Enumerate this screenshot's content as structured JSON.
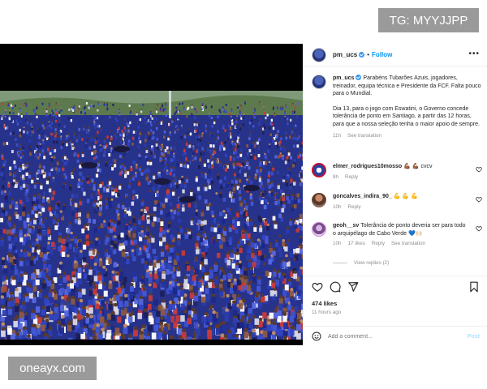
{
  "watermarks": {
    "top": "TG: MYYJJPP",
    "bottom": "oneayx.com"
  },
  "media": {
    "description_icon": "crowd-photo"
  },
  "post": {
    "username": "pm_ucs",
    "follow_label": "Follow",
    "caption_p1": "Parabéns Tubarões Azuis, jogadores, treinador, equipa técnica e Presidente da FCF. Falta pouco para o Mundial.",
    "caption_p2": "Dia 13, para o jogo com Eswatini, o Governo concede tolerância de ponto em Santiago, a partir das 12 horas, para que a nossa seleção tenha o maior apoio de sempre.",
    "caption_time": "11h",
    "see_translation": "See translation"
  },
  "comments": [
    {
      "user": "elmer_rodrigues10mosso",
      "text": "💪🏾 💪🏾 cvcv",
      "time": "8h",
      "reply": "Reply"
    },
    {
      "user": "goncalves_indira_90_",
      "text": "💪 💪 💪",
      "time": "10h",
      "reply": "Reply"
    },
    {
      "user": "geoh__sv",
      "text": "Tolerância de ponto deveria ser para todo o arquipélago de Cabo Verde 💙🙌🏻",
      "time": "10h",
      "likes": "17 likes",
      "reply": "Reply",
      "see_translation": "See translation"
    }
  ],
  "view_replies": "View replies (2)",
  "likes": "474 likes",
  "time_ago": "11 hours ago",
  "add_comment_placeholder": "Add a comment...",
  "post_button": "Post",
  "colors": {
    "accent": "#0095f6",
    "post_disabled": "#b2dffc",
    "crowd_blue": "#2b3fa8",
    "media_bg": "#000000"
  }
}
